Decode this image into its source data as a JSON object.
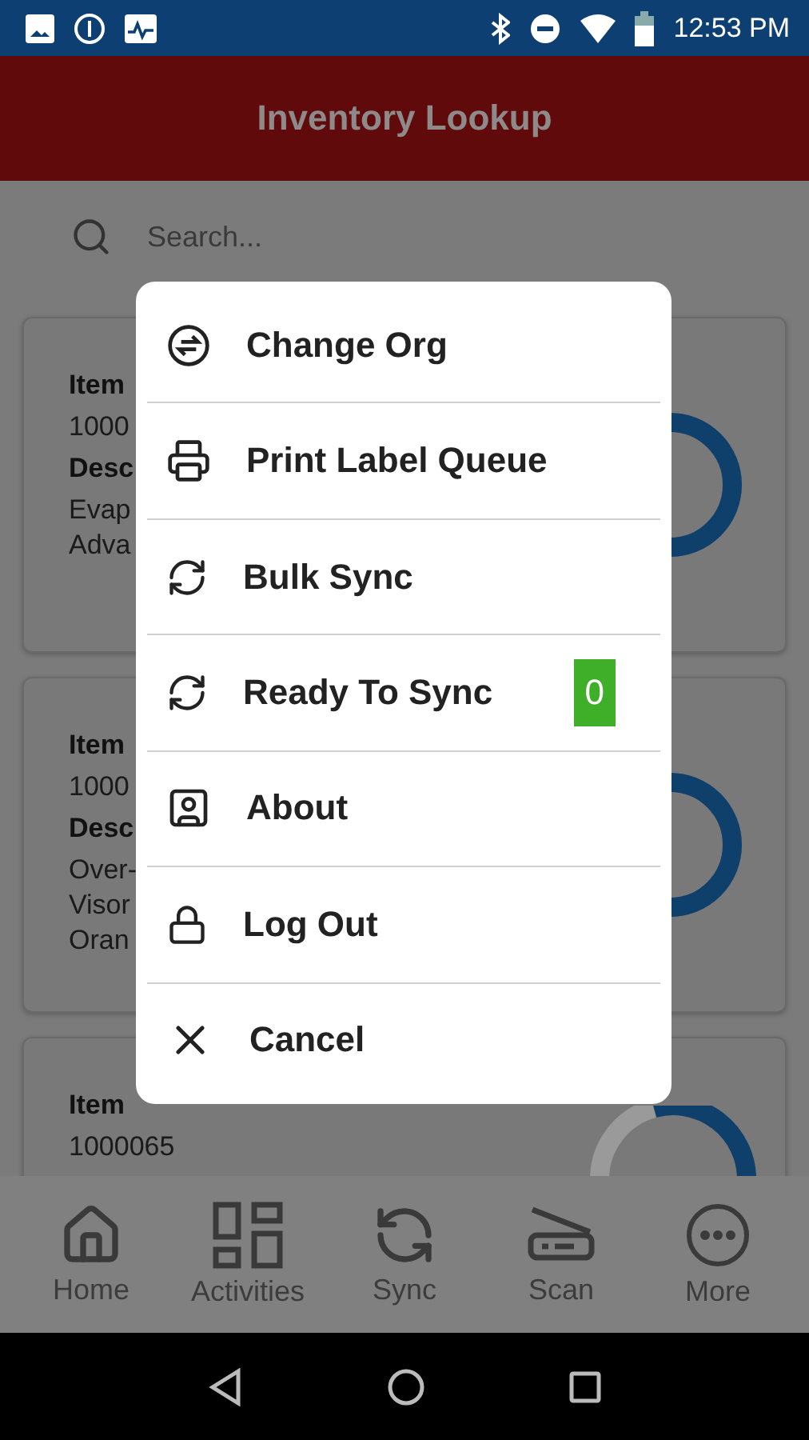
{
  "status_bar": {
    "time": "12:53 PM"
  },
  "header": {
    "title": "Inventory Lookup"
  },
  "search": {
    "placeholder": "Search..."
  },
  "items": [
    {
      "label": "Item",
      "value": "1000",
      "desc_label": "Desc",
      "desc": [
        "Evap",
        "Adva"
      ]
    },
    {
      "label": "Item",
      "value": "1000",
      "desc_label": "Desc",
      "desc": [
        "Over-",
        "Visor",
        "Oran"
      ]
    },
    {
      "label": "Item",
      "value": "1000065"
    }
  ],
  "menu": [
    {
      "label": "Change Org"
    },
    {
      "label": "Print Label Queue"
    },
    {
      "label": "Bulk Sync"
    },
    {
      "label": "Ready To Sync",
      "badge": "0"
    },
    {
      "label": "About"
    },
    {
      "label": "Log Out"
    },
    {
      "label": "Cancel"
    }
  ],
  "nav": [
    {
      "label": "Home"
    },
    {
      "label": "Activities"
    },
    {
      "label": "Sync"
    },
    {
      "label": "Scan"
    },
    {
      "label": "More"
    }
  ]
}
